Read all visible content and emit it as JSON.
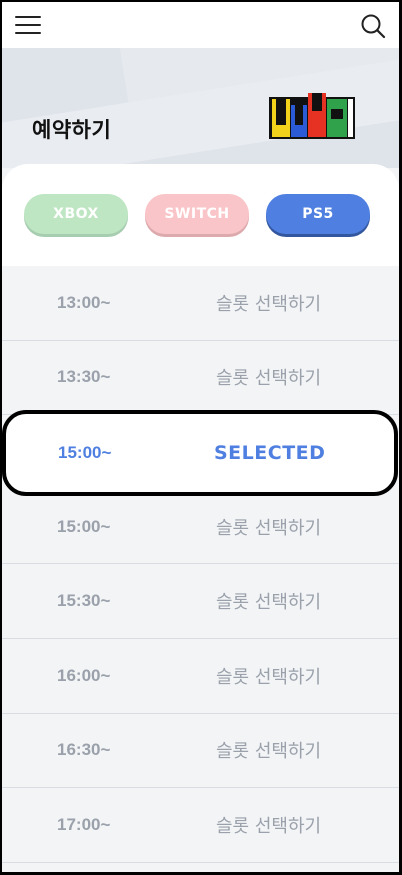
{
  "header": {
    "menu_icon": "hamburger-menu-icon",
    "search_icon": "search-icon"
  },
  "hero": {
    "title": "예약하기",
    "logo": "logo"
  },
  "platforms": {
    "xbox": "XBOX",
    "switch": "SWITCH",
    "ps5": "PS5",
    "colors": {
      "xbox": "#bfe6c3",
      "switch": "#f9c5c8",
      "ps5": "#4f7fe0"
    },
    "selected": "PS5"
  },
  "slots": [
    {
      "time": "13:00~",
      "action": "슬롯 선택하기"
    },
    {
      "time": "13:30~",
      "action": "슬롯 선택하기"
    },
    {
      "time": "15:00~",
      "action": "SELECTED"
    },
    {
      "time": "15:00~",
      "action": "슬롯 선택하기"
    },
    {
      "time": "15:30~",
      "action": "슬롯 선택하기"
    },
    {
      "time": "16:00~",
      "action": "슬롯 선택하기"
    },
    {
      "time": "16:30~",
      "action": "슬롯 선택하기"
    },
    {
      "time": "17:00~",
      "action": "슬롯 선택하기"
    }
  ]
}
